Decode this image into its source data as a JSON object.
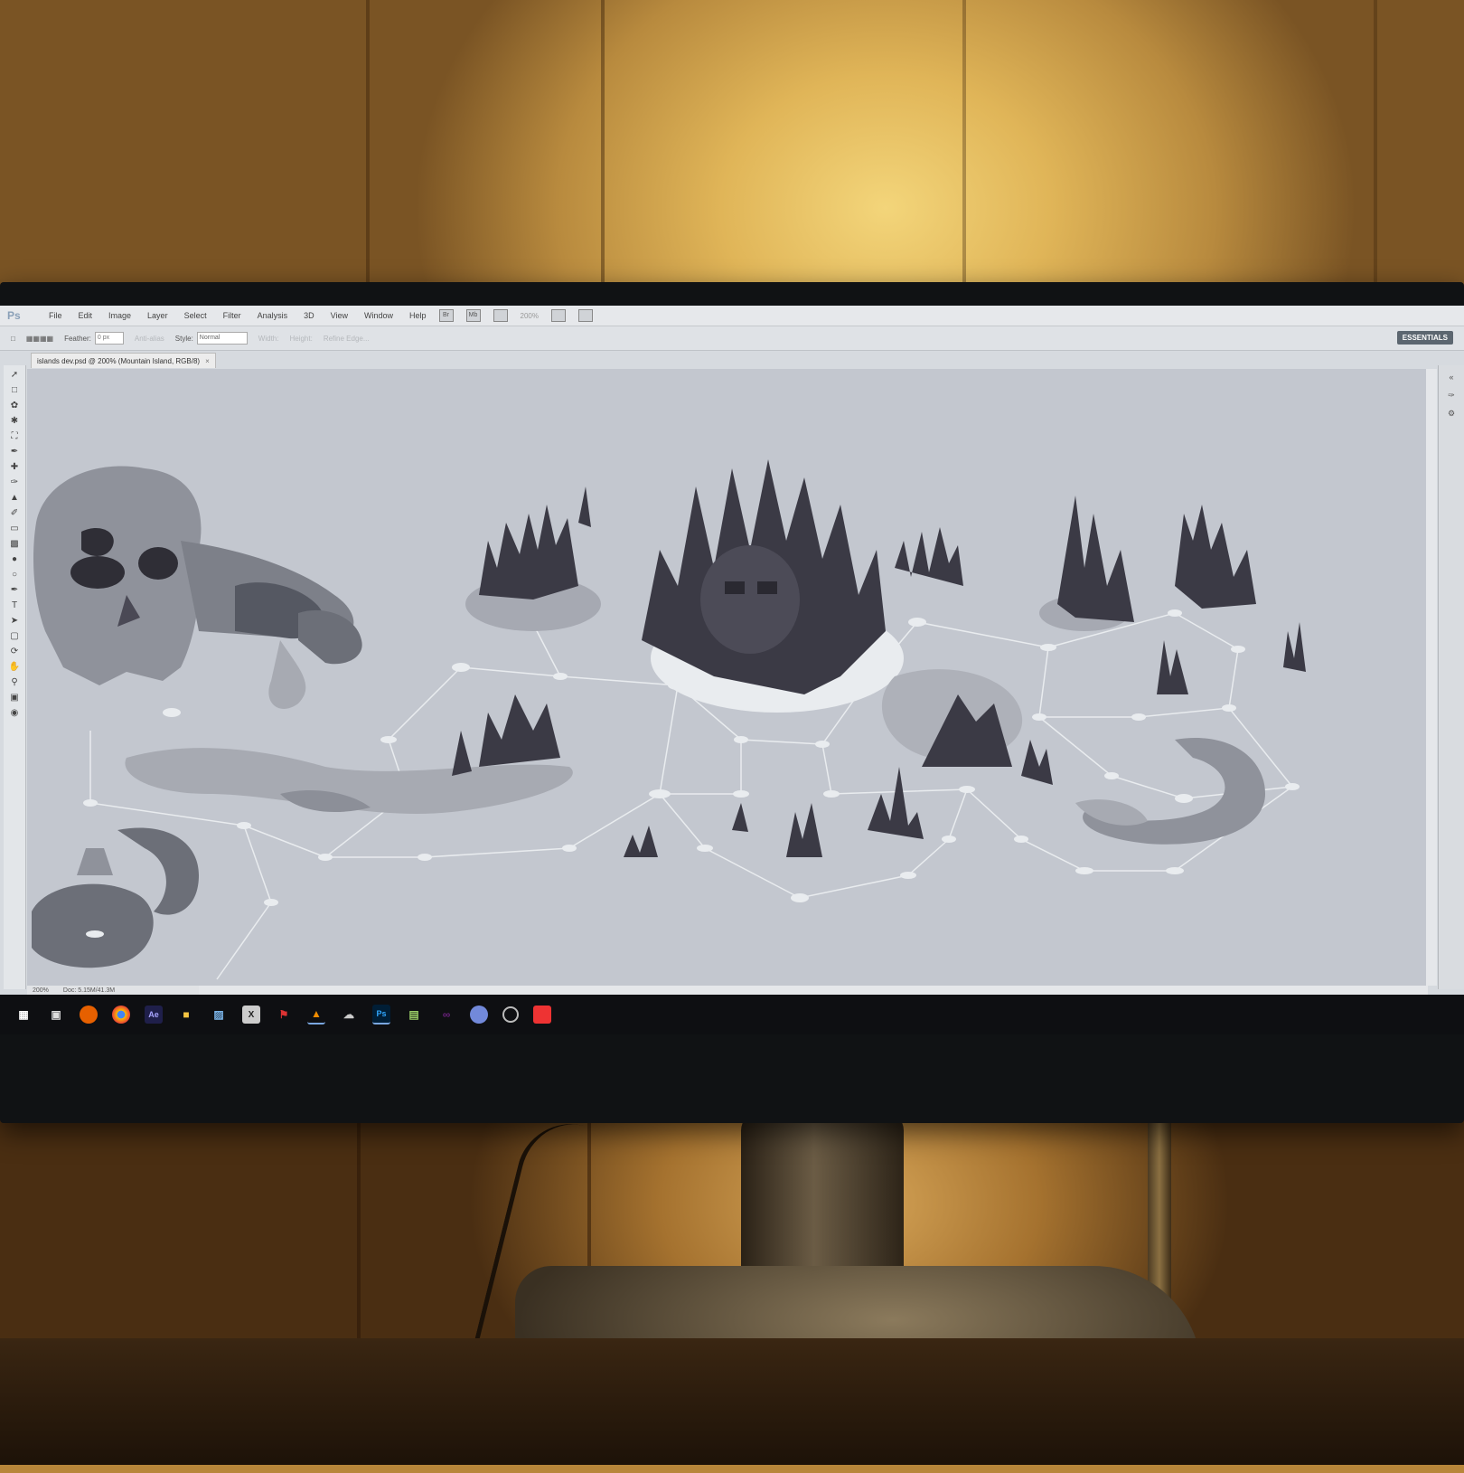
{
  "app": {
    "logo": "Ps"
  },
  "menu": [
    "File",
    "Edit",
    "Image",
    "Layer",
    "Select",
    "Filter",
    "Analysis",
    "3D",
    "View",
    "Window",
    "Help"
  ],
  "menu_icons": [
    "Br",
    "Mb"
  ],
  "zoom_field": "200%",
  "options": {
    "feather_label": "Feather:",
    "feather_value": "0 px",
    "anti_alias": "Anti-alias",
    "style_label": "Style:",
    "style_value": "Normal",
    "width_label": "Width:",
    "height_label": "Height:",
    "refine_edge": "Refine Edge..."
  },
  "workspace": "ESSENTIALS",
  "document_tab": {
    "title": "islands dev.psd @ 200% (Mountain Island, RGB/8)",
    "close": "×"
  },
  "status": {
    "zoom": "200%",
    "doc": "Doc: 5.15M/41.3M"
  },
  "tools": [
    "move-tool",
    "marquee-tool",
    "lasso-tool",
    "quick-select-tool",
    "crop-tool",
    "eyedropper-tool",
    "healing-tool",
    "brush-tool",
    "stamp-tool",
    "history-brush-tool",
    "eraser-tool",
    "gradient-tool",
    "blur-tool",
    "dodge-tool",
    "pen-tool",
    "type-tool",
    "path-select-tool",
    "shape-tool",
    "3d-tool",
    "hand-tool",
    "zoom-tool"
  ],
  "taskbar_icons": [
    "windows-start-icon",
    "task-view-icon",
    "firefox-icon",
    "chrome-icon",
    "aftereffects-icon",
    "folder-icon",
    "capture-icon",
    "excel-icon",
    "pdf-icon",
    "vlc-icon",
    "cloud-icon",
    "photoshop-icon",
    "notepad-icon",
    "visualstudio-icon",
    "discord-icon",
    "obs-icon",
    "app-icon"
  ],
  "colors": {
    "canvas_bg": "#c3c7cf",
    "island_dark": "#3b3a45",
    "island_mid": "#6c6f78",
    "island_light": "#979aa2",
    "path_node": "#e9ecef"
  }
}
